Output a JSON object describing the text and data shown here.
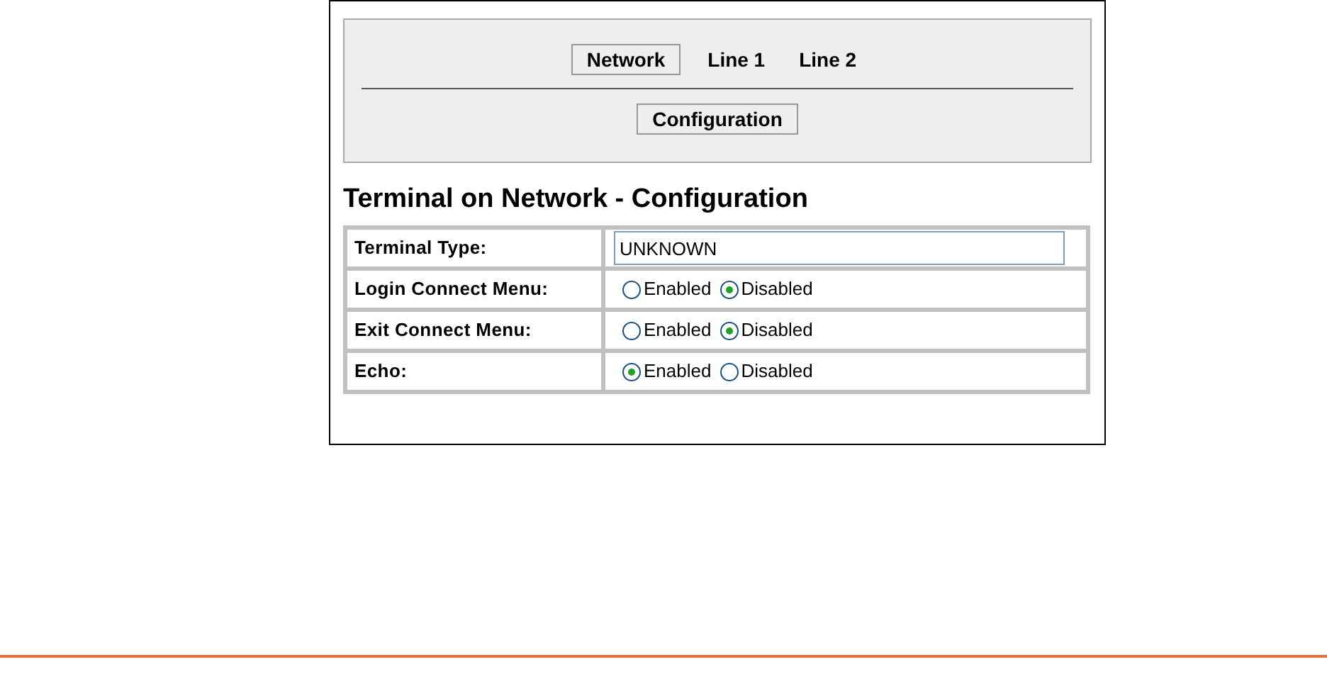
{
  "tabs": [
    {
      "label": "Network",
      "selected": true
    },
    {
      "label": "Line 1",
      "selected": false
    },
    {
      "label": "Line 2",
      "selected": false
    }
  ],
  "subtabs": [
    {
      "label": "Configuration",
      "selected": true
    }
  ],
  "heading": "Terminal on Network - Configuration",
  "rows": [
    {
      "label": "Terminal Type:",
      "kind": "text",
      "value": "UNKNOWN"
    },
    {
      "label": "Login Connect Menu:",
      "kind": "radio",
      "options": [
        {
          "label": "Enabled",
          "selected": false
        },
        {
          "label": "Disabled",
          "selected": true
        }
      ]
    },
    {
      "label": "Exit Connect Menu:",
      "kind": "radio",
      "options": [
        {
          "label": "Enabled",
          "selected": false
        },
        {
          "label": "Disabled",
          "selected": true
        }
      ]
    },
    {
      "label": "Echo:",
      "kind": "radio",
      "options": [
        {
          "label": "Enabled",
          "selected": true
        },
        {
          "label": "Disabled",
          "selected": false
        }
      ]
    }
  ]
}
